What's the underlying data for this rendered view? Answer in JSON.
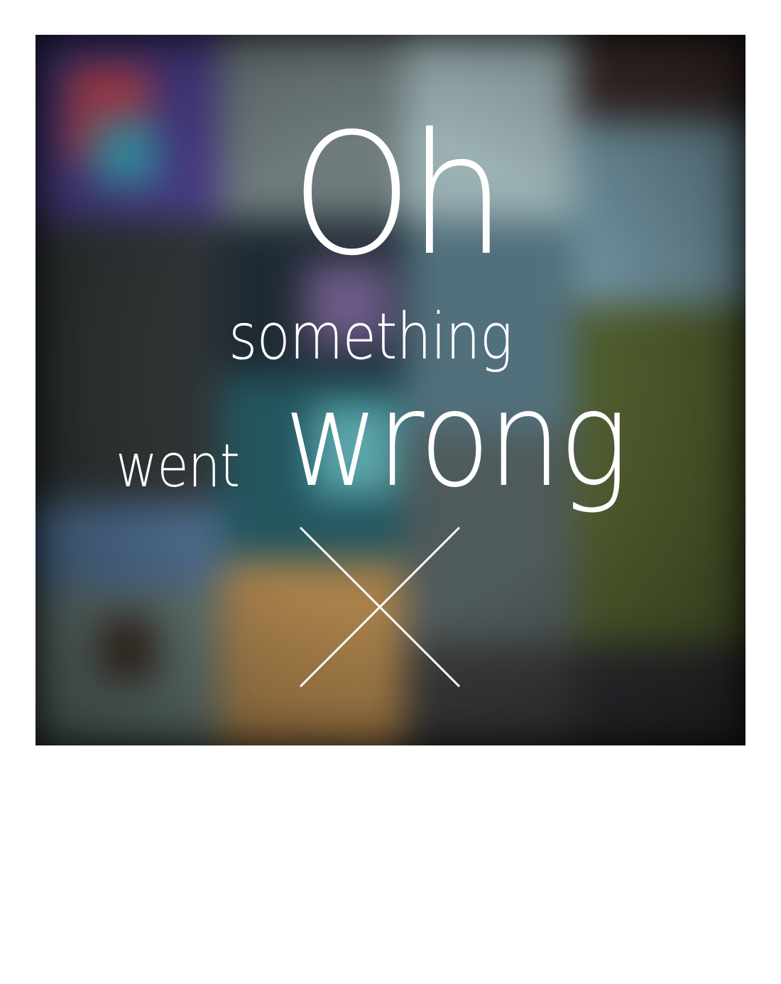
{
  "error": {
    "line1": "Oh",
    "line2": "something",
    "line3_small": "went",
    "line3_large": "wrong",
    "dismiss_icon": "close-x-icon",
    "text_color": "#ffffff"
  },
  "background": {
    "description_colors": [
      "#5b3f8f",
      "#6f7c7d",
      "#8fa3a8",
      "#3a2f2a",
      "#6a8a96",
      "#2a3033",
      "#3b4f5c",
      "#2d6b7a",
      "#4d5a2a",
      "#5a6f6a",
      "#b58a4a",
      "#3a3a3a"
    ]
  }
}
